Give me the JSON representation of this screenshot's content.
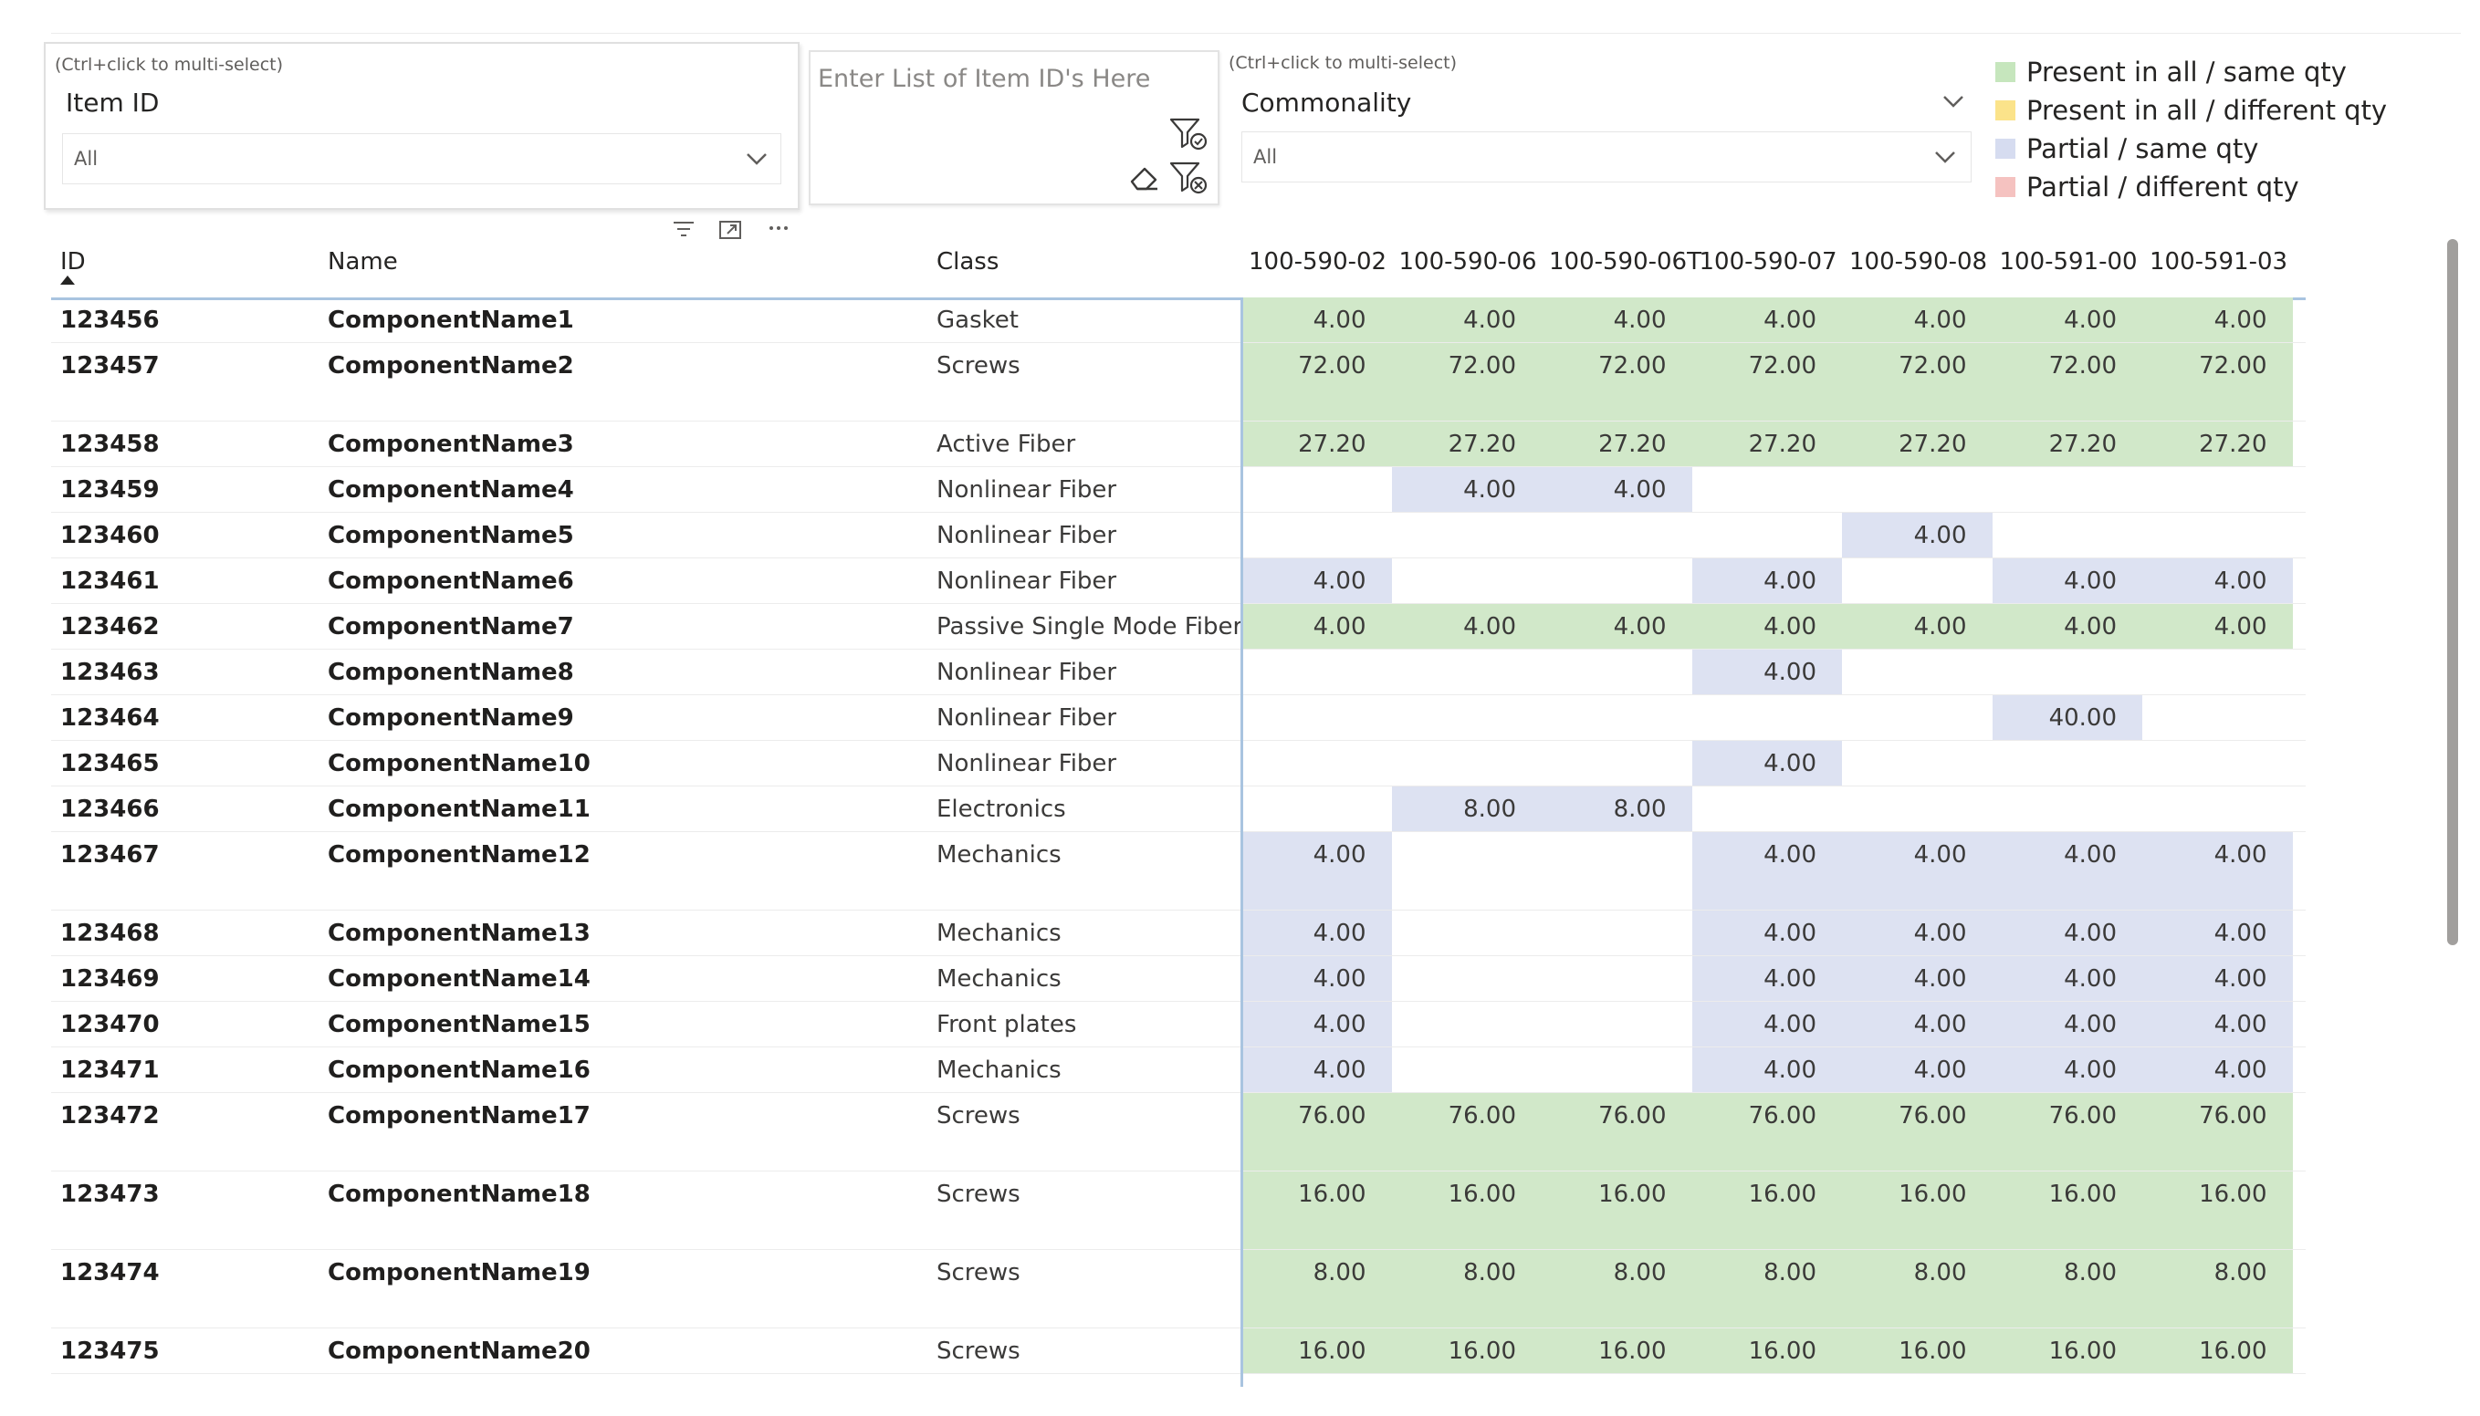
{
  "slicers": {
    "item_id": {
      "hint": "(Ctrl+click to multi-select)",
      "title": "Item ID",
      "value": "All"
    },
    "commonality": {
      "hint": "(Ctrl+click to multi-select)",
      "title": "Commonality",
      "value": "All"
    }
  },
  "text_filter": {
    "placeholder": "Enter List of Item ID's Here"
  },
  "legend": [
    {
      "label": "Present in all / same qty",
      "color": "#c6e6bd"
    },
    {
      "label": "Present in all / different qty",
      "color": "#fbe38a"
    },
    {
      "label": "Partial / same qty",
      "color": "#d6dcf0"
    },
    {
      "label": "Partial / different qty",
      "color": "#f5c2c0"
    }
  ],
  "table": {
    "headers": {
      "id": "ID",
      "name": "Name",
      "class": "Class"
    },
    "columns": [
      "100-590-02",
      "100-590-06",
      "100-590-06T",
      "100-590-07",
      "100-590-08",
      "100-591-00",
      "100-591-03"
    ],
    "rows": [
      {
        "id": "123456",
        "name": "ComponentName1",
        "cls": "Gasket",
        "tall": false,
        "vals": [
          "4.00",
          "4.00",
          "4.00",
          "4.00",
          "4.00",
          "4.00",
          "4.00"
        ],
        "kind": [
          "g",
          "g",
          "g",
          "g",
          "g",
          "g",
          "g"
        ]
      },
      {
        "id": "123457",
        "name": "ComponentName2",
        "cls": "Screws",
        "tall": true,
        "vals": [
          "72.00",
          "72.00",
          "72.00",
          "72.00",
          "72.00",
          "72.00",
          "72.00"
        ],
        "kind": [
          "g",
          "g",
          "g",
          "g",
          "g",
          "g",
          "g"
        ]
      },
      {
        "id": "123458",
        "name": "ComponentName3",
        "cls": "Active Fiber",
        "tall": false,
        "vals": [
          "27.20",
          "27.20",
          "27.20",
          "27.20",
          "27.20",
          "27.20",
          "27.20"
        ],
        "kind": [
          "g",
          "g",
          "g",
          "g",
          "g",
          "g",
          "g"
        ]
      },
      {
        "id": "123459",
        "name": "ComponentName4",
        "cls": "Nonlinear Fiber",
        "tall": false,
        "vals": [
          "",
          "4.00",
          "4.00",
          "",
          "",
          "",
          ""
        ],
        "kind": [
          "",
          "b",
          "b",
          "",
          "",
          "",
          ""
        ]
      },
      {
        "id": "123460",
        "name": "ComponentName5",
        "cls": "Nonlinear Fiber",
        "tall": false,
        "vals": [
          "",
          "",
          "",
          "",
          "4.00",
          "",
          ""
        ],
        "kind": [
          "",
          "",
          "",
          "",
          "b",
          "",
          ""
        ]
      },
      {
        "id": "123461",
        "name": "ComponentName6",
        "cls": "Nonlinear Fiber",
        "tall": false,
        "vals": [
          "4.00",
          "",
          "",
          "4.00",
          "",
          "4.00",
          "4.00"
        ],
        "kind": [
          "b",
          "",
          "",
          "b",
          "",
          "b",
          "b"
        ]
      },
      {
        "id": "123462",
        "name": "ComponentName7",
        "cls": "Passive Single Mode Fiber",
        "tall": false,
        "vals": [
          "4.00",
          "4.00",
          "4.00",
          "4.00",
          "4.00",
          "4.00",
          "4.00"
        ],
        "kind": [
          "g",
          "g",
          "g",
          "g",
          "g",
          "g",
          "g"
        ]
      },
      {
        "id": "123463",
        "name": "ComponentName8",
        "cls": "Nonlinear Fiber",
        "tall": false,
        "vals": [
          "",
          "",
          "",
          "4.00",
          "",
          "",
          ""
        ],
        "kind": [
          "",
          "",
          "",
          "b",
          "",
          "",
          ""
        ]
      },
      {
        "id": "123464",
        "name": "ComponentName9",
        "cls": "Nonlinear Fiber",
        "tall": false,
        "vals": [
          "",
          "",
          "",
          "",
          "",
          "40.00",
          ""
        ],
        "kind": [
          "",
          "",
          "",
          "",
          "",
          "b",
          ""
        ]
      },
      {
        "id": "123465",
        "name": "ComponentName10",
        "cls": "Nonlinear Fiber",
        "tall": false,
        "vals": [
          "",
          "",
          "",
          "4.00",
          "",
          "",
          ""
        ],
        "kind": [
          "",
          "",
          "",
          "b",
          "",
          "",
          ""
        ]
      },
      {
        "id": "123466",
        "name": "ComponentName11",
        "cls": "Electronics",
        "tall": false,
        "vals": [
          "",
          "8.00",
          "8.00",
          "",
          "",
          "",
          ""
        ],
        "kind": [
          "",
          "b",
          "b",
          "",
          "",
          "",
          ""
        ]
      },
      {
        "id": "123467",
        "name": "ComponentName12",
        "cls": "Mechanics",
        "tall": true,
        "vals": [
          "4.00",
          "",
          "",
          "4.00",
          "4.00",
          "4.00",
          "4.00"
        ],
        "kind": [
          "b",
          "",
          "",
          "b",
          "b",
          "b",
          "b"
        ]
      },
      {
        "id": "123468",
        "name": "ComponentName13",
        "cls": "Mechanics",
        "tall": false,
        "vals": [
          "4.00",
          "",
          "",
          "4.00",
          "4.00",
          "4.00",
          "4.00"
        ],
        "kind": [
          "b",
          "",
          "",
          "b",
          "b",
          "b",
          "b"
        ]
      },
      {
        "id": "123469",
        "name": "ComponentName14",
        "cls": "Mechanics",
        "tall": false,
        "vals": [
          "4.00",
          "",
          "",
          "4.00",
          "4.00",
          "4.00",
          "4.00"
        ],
        "kind": [
          "b",
          "",
          "",
          "b",
          "b",
          "b",
          "b"
        ]
      },
      {
        "id": "123470",
        "name": "ComponentName15",
        "cls": "Front plates",
        "tall": false,
        "vals": [
          "4.00",
          "",
          "",
          "4.00",
          "4.00",
          "4.00",
          "4.00"
        ],
        "kind": [
          "b",
          "",
          "",
          "b",
          "b",
          "b",
          "b"
        ]
      },
      {
        "id": "123471",
        "name": "ComponentName16",
        "cls": "Mechanics",
        "tall": false,
        "vals": [
          "4.00",
          "",
          "",
          "4.00",
          "4.00",
          "4.00",
          "4.00"
        ],
        "kind": [
          "b",
          "",
          "",
          "b",
          "b",
          "b",
          "b"
        ]
      },
      {
        "id": "123472",
        "name": "ComponentName17",
        "cls": "Screws",
        "tall": true,
        "vals": [
          "76.00",
          "76.00",
          "76.00",
          "76.00",
          "76.00",
          "76.00",
          "76.00"
        ],
        "kind": [
          "g",
          "g",
          "g",
          "g",
          "g",
          "g",
          "g"
        ]
      },
      {
        "id": "123473",
        "name": "ComponentName18",
        "cls": "Screws",
        "tall": true,
        "vals": [
          "16.00",
          "16.00",
          "16.00",
          "16.00",
          "16.00",
          "16.00",
          "16.00"
        ],
        "kind": [
          "g",
          "g",
          "g",
          "g",
          "g",
          "g",
          "g"
        ]
      },
      {
        "id": "123474",
        "name": "ComponentName19",
        "cls": "Screws",
        "tall": true,
        "vals": [
          "8.00",
          "8.00",
          "8.00",
          "8.00",
          "8.00",
          "8.00",
          "8.00"
        ],
        "kind": [
          "g",
          "g",
          "g",
          "g",
          "g",
          "g",
          "g"
        ]
      },
      {
        "id": "123475",
        "name": "ComponentName20",
        "cls": "Screws",
        "tall": false,
        "vals": [
          "16.00",
          "16.00",
          "16.00",
          "16.00",
          "16.00",
          "16.00",
          "16.00"
        ],
        "kind": [
          "g",
          "g",
          "g",
          "g",
          "g",
          "g",
          "g"
        ]
      }
    ]
  },
  "icons": {
    "header_menu": [
      "filter-lines-icon",
      "focus-mode-icon",
      "more-options-icon"
    ],
    "text_filter": [
      "apply-filter-icon",
      "eraser-icon",
      "clear-filter-icon"
    ]
  }
}
